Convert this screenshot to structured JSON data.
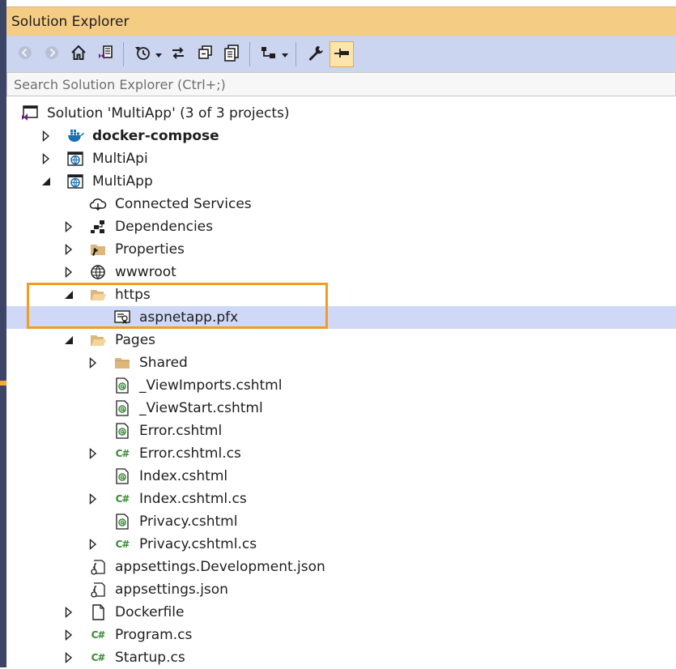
{
  "window": {
    "title": "Solution Explorer"
  },
  "toolbar": {
    "buttons": [
      {
        "icon": "back-icon"
      },
      {
        "icon": "forward-icon"
      },
      {
        "icon": "home-icon"
      },
      {
        "icon": "switch-views-icon"
      },
      {
        "icon": "pending-changes-filter-icon",
        "has_dropdown": true
      },
      {
        "icon": "sync-with-active-document-icon"
      },
      {
        "icon": "collapse-all-icon"
      },
      {
        "icon": "show-all-files-icon"
      },
      {
        "icon": "preview-selected-items-icon",
        "has_dropdown": true
      },
      {
        "icon": "properties-wrench-icon"
      },
      {
        "icon": "pin-icon",
        "active": true
      }
    ]
  },
  "search": {
    "placeholder": "Search Solution Explorer (Ctrl+;)"
  },
  "tree": {
    "rows": [
      {
        "label": "Solution 'MultiApp' (3 of 3 projects)",
        "icon": "solution-icon",
        "expander": "none"
      },
      {
        "label": "docker-compose",
        "icon": "docker-compose-icon",
        "expander": "collapsed",
        "bold": true
      },
      {
        "label": "MultiApi",
        "icon": "web-project-icon",
        "expander": "collapsed"
      },
      {
        "label": "MultiApp",
        "icon": "web-project-icon",
        "expander": "expanded"
      },
      {
        "label": "Connected Services",
        "icon": "connected-services-icon",
        "expander": "none"
      },
      {
        "label": "Dependencies",
        "icon": "dependencies-icon",
        "expander": "collapsed"
      },
      {
        "label": "Properties",
        "icon": "properties-folder-icon",
        "expander": "collapsed"
      },
      {
        "label": "wwwroot",
        "icon": "globe-icon",
        "expander": "collapsed"
      },
      {
        "label": "https",
        "icon": "folder-open-icon",
        "expander": "expanded"
      },
      {
        "label": "aspnetapp.pfx",
        "icon": "certificate-icon",
        "expander": "none",
        "selected": true
      },
      {
        "label": "Pages",
        "icon": "folder-open-icon",
        "expander": "expanded"
      },
      {
        "label": "Shared",
        "icon": "folder-icon",
        "expander": "collapsed"
      },
      {
        "label": "_ViewImports.cshtml",
        "icon": "razor-file-icon",
        "expander": "none"
      },
      {
        "label": "_ViewStart.cshtml",
        "icon": "razor-file-icon",
        "expander": "none"
      },
      {
        "label": "Error.cshtml",
        "icon": "razor-file-icon",
        "expander": "none"
      },
      {
        "label": "Error.cshtml.cs",
        "icon": "csharp-file-icon",
        "expander": "collapsed"
      },
      {
        "label": "Index.cshtml",
        "icon": "razor-file-icon",
        "expander": "none"
      },
      {
        "label": "Index.cshtml.cs",
        "icon": "csharp-file-icon",
        "expander": "collapsed"
      },
      {
        "label": "Privacy.cshtml",
        "icon": "razor-file-icon",
        "expander": "none"
      },
      {
        "label": "Privacy.cshtml.cs",
        "icon": "csharp-file-icon",
        "expander": "collapsed"
      },
      {
        "label": "appsettings.Development.json",
        "icon": "json-file-icon",
        "expander": "none"
      },
      {
        "label": "appsettings.json",
        "icon": "json-file-icon",
        "expander": "none"
      },
      {
        "label": "Dockerfile",
        "icon": "file-icon",
        "expander": "collapsed"
      },
      {
        "label": "Program.cs",
        "icon": "csharp-file-icon",
        "expander": "collapsed"
      },
      {
        "label": "Startup.cs",
        "icon": "csharp-file-icon",
        "expander": "collapsed"
      }
    ]
  },
  "colors": {
    "title_bar": "#f5cc84",
    "toolbar": "#ccd5f0",
    "selection": "#cfd8f6",
    "highlight_border": "#f39c24",
    "csharp_green": "#388a34",
    "vs_purple": "#68217a"
  }
}
